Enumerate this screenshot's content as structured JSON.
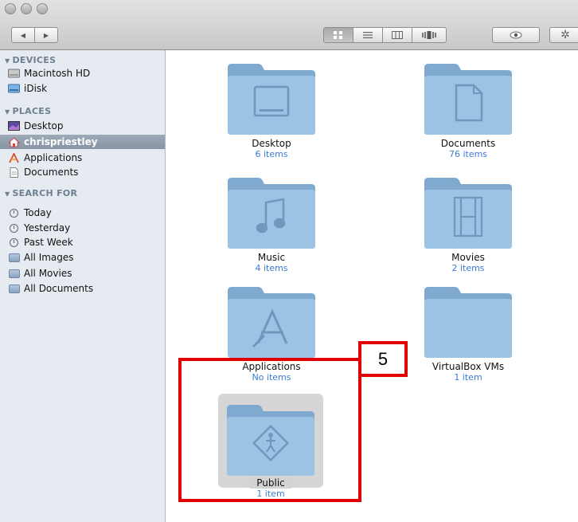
{
  "window": {
    "nav_back": "◀",
    "nav_forward": "▶",
    "views": [
      "icon-view",
      "list-view",
      "column-view",
      "coverflow-view"
    ],
    "action": "gear-icon",
    "quicklook": "eye-icon"
  },
  "sidebar": {
    "devices_header": "DEVICES",
    "devices": [
      {
        "label": "Macintosh HD",
        "icon": "hard-drive-icon"
      },
      {
        "label": "iDisk",
        "icon": "idisk-icon"
      }
    ],
    "places_header": "PLACES",
    "places": [
      {
        "label": "Desktop",
        "icon": "desktop-icon"
      },
      {
        "label": "chrispriestley",
        "icon": "home-icon",
        "selected": true
      },
      {
        "label": "Applications",
        "icon": "applications-icon"
      },
      {
        "label": "Documents",
        "icon": "documents-icon"
      }
    ],
    "search_header": "SEARCH FOR",
    "search": [
      {
        "label": "Today",
        "icon": "clock-icon"
      },
      {
        "label": "Yesterday",
        "icon": "clock-icon"
      },
      {
        "label": "Past Week",
        "icon": "clock-icon"
      },
      {
        "label": "All Images",
        "icon": "smart-folder-icon"
      },
      {
        "label": "All Movies",
        "icon": "smart-folder-icon"
      },
      {
        "label": "All Documents",
        "icon": "smart-folder-icon"
      }
    ]
  },
  "items": [
    {
      "name": "Desktop",
      "count": "6 items",
      "glyph": "desktop"
    },
    {
      "name": "Documents",
      "count": "76 items",
      "glyph": "document"
    },
    {
      "name": "Music",
      "count": "4 items",
      "glyph": "music"
    },
    {
      "name": "Movies",
      "count": "2 items",
      "glyph": "film"
    },
    {
      "name": "Applications",
      "count": "No items",
      "glyph": "apps"
    },
    {
      "name": "VirtualBox VMs",
      "count": "1 item",
      "glyph": "none"
    },
    {
      "name": "Public",
      "count": "1 item",
      "glyph": "public",
      "selected": true
    }
  ],
  "annotation": {
    "label": "5",
    "color": "#e00000"
  },
  "colors": {
    "folder_blue": "#8fb6d8",
    "count_blue": "#3a7bd5",
    "selection": "#8794a4"
  }
}
